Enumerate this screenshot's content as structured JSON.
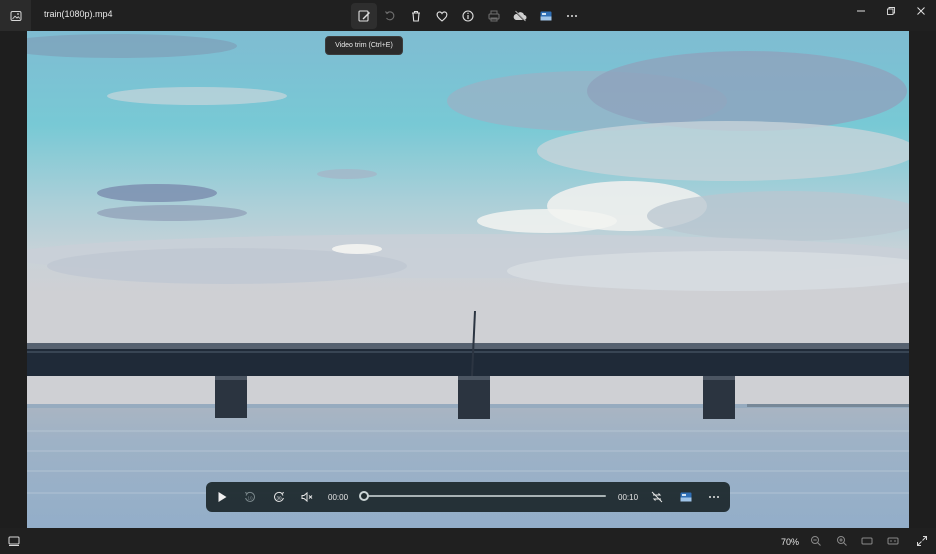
{
  "window": {
    "title": "train(1080p).mp4",
    "toolbar_icons": [
      "edit-video-icon",
      "rotate-icon",
      "delete-icon",
      "favorite-icon",
      "info-icon",
      "print-icon",
      "onedrive-icon",
      "clipchamp-icon",
      "more-icon"
    ],
    "active_tool": "edit-video-icon",
    "controls": [
      "minimize-icon",
      "maximize-icon",
      "close-icon"
    ]
  },
  "tooltip": {
    "text": "Video trim (Ctrl+E)"
  },
  "player": {
    "current_time": "00:00",
    "duration": "00:10",
    "progress": 0,
    "rewind_seconds": "10",
    "forward_seconds": "30",
    "muted": true
  },
  "statusbar": {
    "zoom": "70%"
  },
  "colors": {
    "window_bg": "#202020",
    "playbar_bg": "#1c282c",
    "sky_top": "#6fc8d6",
    "water": "#9fb4c6"
  }
}
